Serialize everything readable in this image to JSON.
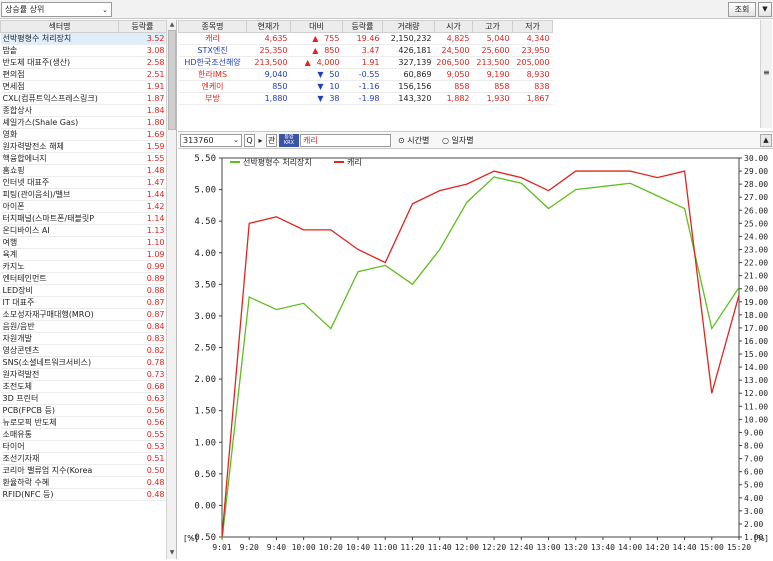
{
  "topbar": {
    "sort_select": "상승률 상위",
    "query_button": "조회",
    "menu_button": "▼"
  },
  "theme_table": {
    "headers": [
      "섹터명",
      "등락률"
    ],
    "rows": [
      [
        "선박평형수 처리장치",
        "3.52"
      ],
      [
        "밥솥",
        "3.08"
      ],
      [
        "반도체 대표주(생산)",
        "2.58"
      ],
      [
        "편의점",
        "2.51"
      ],
      [
        "면세점",
        "1.91"
      ],
      [
        "CXL(컴퓨트익스프레스링크)",
        "1.87"
      ],
      [
        "종합상사",
        "1.84"
      ],
      [
        "셰일가스(Shale Gas)",
        "1.80"
      ],
      [
        "영화",
        "1.69"
      ],
      [
        "원자력발전소 해체",
        "1.59"
      ],
      [
        "핵융합에너지",
        "1.55"
      ],
      [
        "홈쇼핑",
        "1.48"
      ],
      [
        "인터넷 대표주",
        "1.47"
      ],
      [
        "피팅(관이음쇠)/밸브",
        "1.44"
      ],
      [
        "아이폰",
        "1.42"
      ],
      [
        "터치패널(스마트폰/태블릿P",
        "1.14"
      ],
      [
        "온디바이스 AI",
        "1.13"
      ],
      [
        "여행",
        "1.10"
      ],
      [
        "육계",
        "1.09"
      ],
      [
        "카지노",
        "0.99"
      ],
      [
        "엔터테인먼트",
        "0.89"
      ],
      [
        "LED장비",
        "0.88"
      ],
      [
        "IT 대표주",
        "0.87"
      ],
      [
        "소모성자재구매대행(MRO)",
        "0.87"
      ],
      [
        "음원/음반",
        "0.84"
      ],
      [
        "자원개발",
        "0.83"
      ],
      [
        "영상콘텐츠",
        "0.82"
      ],
      [
        "SNS(소셜네트워크서비스)",
        "0.78"
      ],
      [
        "원자력발전",
        "0.73"
      ],
      [
        "초전도체",
        "0.68"
      ],
      [
        "3D 프린터",
        "0.63"
      ],
      [
        "PCB(FPCB 등)",
        "0.56"
      ],
      [
        "뉴로모픽 반도체",
        "0.56"
      ],
      [
        "소매유통",
        "0.55"
      ],
      [
        "타이어",
        "0.53"
      ],
      [
        "조선기자재",
        "0.51"
      ],
      [
        "코리아 밸류업 지수(Korea",
        "0.50"
      ],
      [
        "환율하락 수혜",
        "0.48"
      ],
      [
        "RFID(NFC 등)",
        "0.48"
      ]
    ]
  },
  "stock_table": {
    "headers": [
      "종목명",
      "현재가",
      "대비",
      "등락률",
      "거래량",
      "시가",
      "고가",
      "저가"
    ],
    "rows": [
      {
        "name": "캐리",
        "name_color": "#e0241e",
        "price": "4,635",
        "sign": "▲",
        "sign_color": "#e0241e",
        "diff": "755",
        "rate": "19.46",
        "vol": "2,150,232",
        "open": "4,825",
        "high": "5,040",
        "low": "4,340"
      },
      {
        "name": "STX엔진",
        "name_color": "#1f3fbf",
        "price": "25,350",
        "sign": "▲",
        "sign_color": "#e0241e",
        "diff": "850",
        "rate": "3.47",
        "vol": "426,181",
        "open": "24,500",
        "high": "25,600",
        "low": "23,950"
      },
      {
        "name": "HD한국조선해양",
        "name_color": "#1f3fbf",
        "price": "213,500",
        "sign": "▲",
        "sign_color": "#e0241e",
        "diff": "4,000",
        "rate": "1.91",
        "vol": "327,139",
        "open": "206,500",
        "high": "213,500",
        "low": "205,000"
      },
      {
        "name": "한라IMS",
        "name_color": "#e0241e",
        "price": "9,040",
        "sign": "▼",
        "sign_color": "#1f3fbf",
        "diff": "50",
        "rate": "-0.55",
        "vol": "60,869",
        "open": "9,050",
        "high": "9,190",
        "low": "8,930"
      },
      {
        "name": "엔케이",
        "name_color": "#e0241e",
        "price": "850",
        "sign": "▼",
        "sign_color": "#1f3fbf",
        "diff": "10",
        "rate": "-1.16",
        "vol": "156,156",
        "open": "858",
        "high": "858",
        "low": "838"
      },
      {
        "name": "부방",
        "name_color": "#e0241e",
        "price": "1,880",
        "sign": "▼",
        "sign_color": "#1f3fbf",
        "diff": "38",
        "rate": "-1.98",
        "vol": "143,320",
        "open": "1,882",
        "high": "1,930",
        "low": "1,867"
      }
    ]
  },
  "codebar": {
    "code": "313760",
    "q_icon": "Q",
    "arrow": "▸",
    "gwan": "관",
    "krx_top": "통합",
    "krx_bottom": "KRX",
    "stock_name": "캐리",
    "radio_time": "시간별",
    "radio_day": "일자별"
  },
  "chart_data": {
    "type": "line",
    "legend": [
      "선박평형수 처리장치",
      "캐리"
    ],
    "colors": [
      "#5fbf1f",
      "#e0241e"
    ],
    "x_ticks": [
      "9:01",
      "9:20",
      "9:40",
      "10:00",
      "10:20",
      "10:40",
      "11:00",
      "11:20",
      "11:40",
      "12:00",
      "12:20",
      "12:40",
      "13:00",
      "13:20",
      "13:40",
      "14:00",
      "14:20",
      "14:40",
      "15:00",
      "15:20"
    ],
    "y_left_ticks": [
      "5.50",
      "5.00",
      "4.50",
      "4.00",
      "3.50",
      "3.00",
      "2.50",
      "2.00",
      "1.50",
      "1.00",
      "0.50",
      "0.00",
      "-0.50"
    ],
    "y_right_ticks": [
      "30.00",
      "29.00",
      "28.00",
      "27.00",
      "26.00",
      "25.00",
      "24.00",
      "23.00",
      "22.00",
      "21.00",
      "20.00",
      "19.00",
      "18.00",
      "17.00",
      "16.00",
      "15.00",
      "14.00",
      "13.00",
      "12.00",
      "11.00",
      "10.00",
      "9.00",
      "8.00",
      "7.00",
      "6.00",
      "5.00",
      "4.00",
      "3.00",
      "2.00",
      "1.00"
    ],
    "y_left_range": [
      -0.5,
      5.5
    ],
    "y_right_range": [
      1,
      30
    ],
    "unit_left": "[%]",
    "unit_right": "[%]",
    "series": [
      {
        "name": "선박평형수 처리장치",
        "axis": "left",
        "x": [
          0,
          1,
          2,
          3,
          4,
          5,
          6,
          7,
          8,
          9,
          10,
          11,
          12,
          13,
          14,
          15,
          16,
          17,
          18,
          19
        ],
        "values": [
          -0.55,
          3.3,
          3.1,
          3.2,
          2.8,
          3.7,
          3.8,
          3.5,
          4.05,
          4.8,
          5.2,
          5.1,
          4.7,
          5.0,
          5.05,
          5.1,
          4.9,
          4.7,
          2.8,
          3.45
        ]
      },
      {
        "name": "캐리",
        "axis": "right",
        "x": [
          0,
          1,
          2,
          3,
          4,
          5,
          6,
          7,
          8,
          9,
          10,
          11,
          12,
          13,
          14,
          15,
          16,
          17,
          18,
          19
        ],
        "values": [
          1,
          25,
          25.5,
          24.5,
          24.5,
          23,
          22,
          26.5,
          27.5,
          28,
          29,
          28.5,
          27.5,
          29,
          29,
          29,
          28.5,
          29,
          12,
          19.5
        ]
      }
    ]
  }
}
